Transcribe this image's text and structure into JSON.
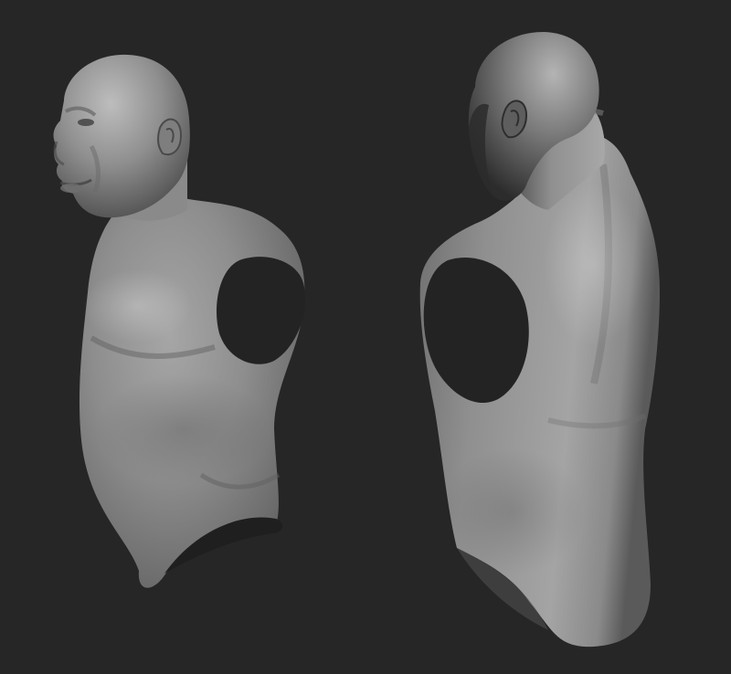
{
  "scene": {
    "background_color": "#262626",
    "surface_color": "#8c8c8c",
    "highlight_color": "#b8b8b8",
    "shadow_color": "#1e1e1e",
    "views": [
      {
        "name": "front-three-quarter-view"
      },
      {
        "name": "back-three-quarter-view"
      }
    ]
  }
}
